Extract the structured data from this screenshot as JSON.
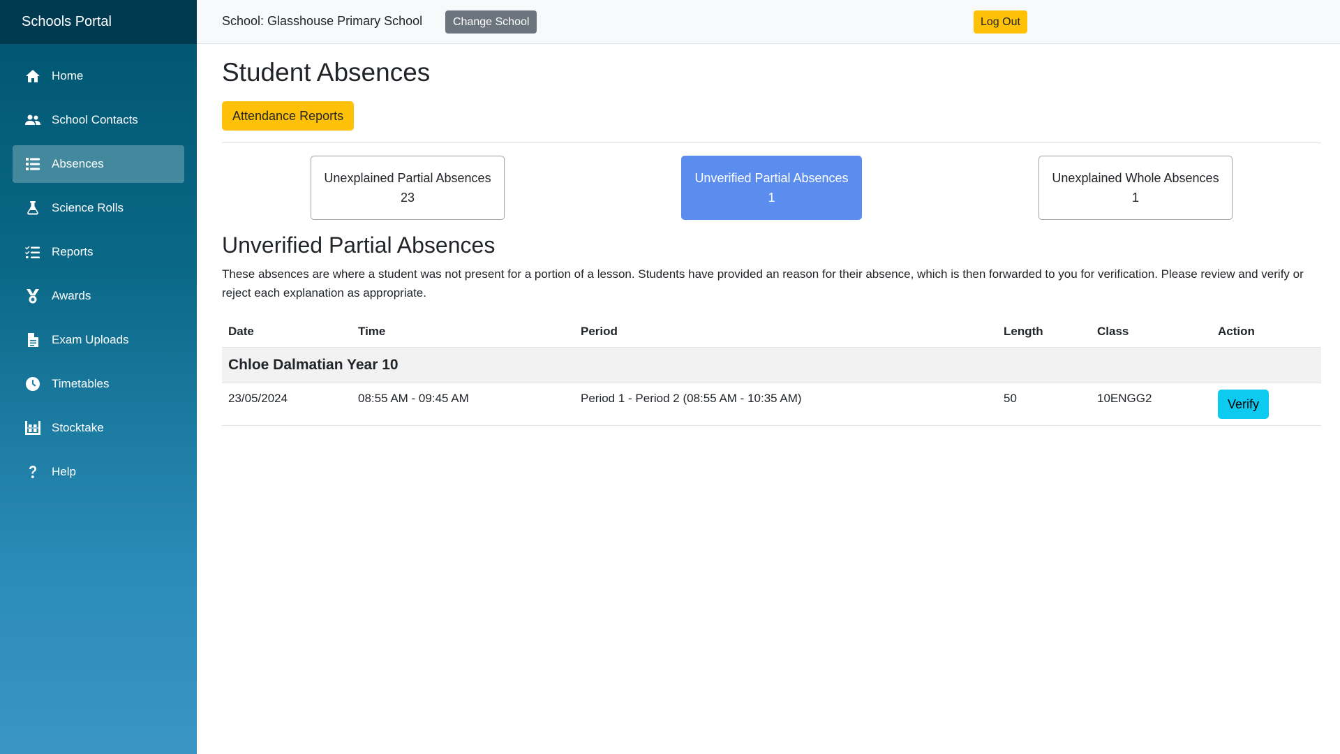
{
  "app": {
    "brand": "Schools Portal"
  },
  "sidebar": {
    "items": [
      {
        "label": "Home",
        "icon": "home-icon",
        "active": false
      },
      {
        "label": "School Contacts",
        "icon": "users-icon",
        "active": false
      },
      {
        "label": "Absences",
        "icon": "list-icon",
        "active": true
      },
      {
        "label": "Science Rolls",
        "icon": "flask-icon",
        "active": false
      },
      {
        "label": "Reports",
        "icon": "checklist-icon",
        "active": false
      },
      {
        "label": "Awards",
        "icon": "medal-icon",
        "active": false
      },
      {
        "label": "Exam Uploads",
        "icon": "document-icon",
        "active": false
      },
      {
        "label": "Timetables",
        "icon": "clock-icon",
        "active": false
      },
      {
        "label": "Stocktake",
        "icon": "warehouse-icon",
        "active": false
      },
      {
        "label": "Help",
        "icon": "question-icon",
        "active": false
      }
    ]
  },
  "topbar": {
    "school_label": "School: Glasshouse Primary School",
    "change_school": "Change School",
    "log_out": "Log Out"
  },
  "main": {
    "title": "Student Absences",
    "attendance_reports": "Attendance Reports",
    "cards": [
      {
        "label": "Unexplained Partial Absences",
        "count": "23",
        "active": false
      },
      {
        "label": "Unverified Partial Absences",
        "count": "1",
        "active": true
      },
      {
        "label": "Unexplained Whole Absences",
        "count": "1",
        "active": false
      }
    ],
    "section_title": "Unverified Partial Absences",
    "description": "These absences are where a student was not present for a portion of a lesson. Students have provided an reason for their absence, which is then forwarded to you for verification. Please review and verify or reject each explanation as appropriate.",
    "table": {
      "headers": {
        "date": "Date",
        "time": "Time",
        "period": "Period",
        "length": "Length",
        "class": "Class",
        "action": "Action"
      },
      "group": "Chloe Dalmatian Year 10",
      "rows": [
        {
          "date": "23/05/2024",
          "time": "08:55 AM - 09:45 AM",
          "period": "Period 1 - Period 2 (08:55 AM - 10:35 AM)",
          "length": "50",
          "class": "10ENGG2",
          "action": "Verify"
        }
      ]
    }
  },
  "colors": {
    "sidebar_top": "#00546f",
    "sidebar_bottom": "#3a95c4",
    "brand_bar": "#003a50",
    "warning": "#ffc107",
    "active_card": "#5b8def",
    "verify": "#0dcaf0",
    "secondary": "#6c757d"
  }
}
